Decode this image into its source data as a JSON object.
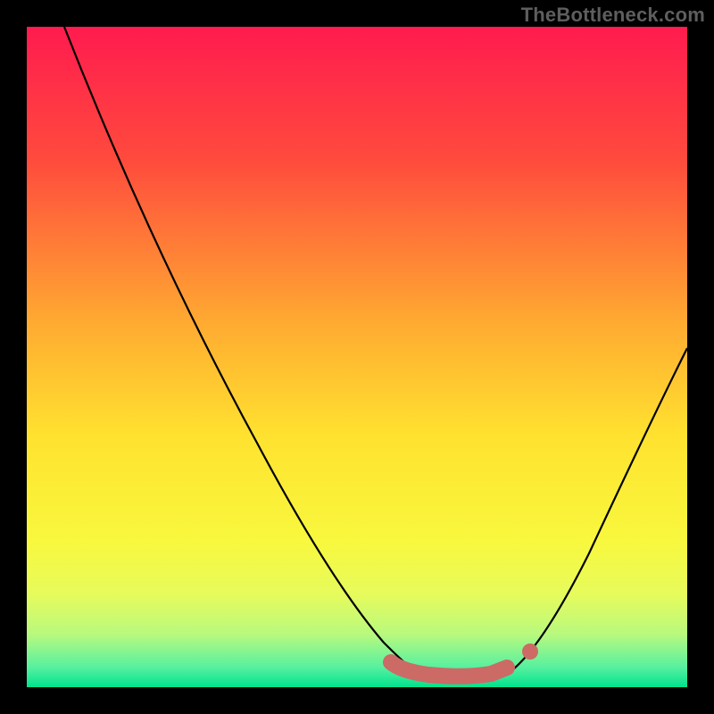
{
  "watermark": "TheBottleneck.com",
  "chart_data": {
    "type": "line",
    "title": "",
    "xlabel": "",
    "ylabel": "",
    "xlim": [
      0,
      100
    ],
    "ylim": [
      0,
      100
    ],
    "grid": false,
    "legend": false,
    "background": {
      "type": "vertical-gradient",
      "stops": [
        {
          "pos": 0.0,
          "color": "#ff1b4f"
        },
        {
          "pos": 0.2,
          "color": "#ff4a3d"
        },
        {
          "pos": 0.45,
          "color": "#ffab31"
        },
        {
          "pos": 0.62,
          "color": "#ffe22f"
        },
        {
          "pos": 0.78,
          "color": "#f8f83e"
        },
        {
          "pos": 0.86,
          "color": "#e6fb5c"
        },
        {
          "pos": 0.92,
          "color": "#b8f97e"
        },
        {
          "pos": 0.97,
          "color": "#57f0a0"
        },
        {
          "pos": 1.0,
          "color": "#00e38d"
        }
      ]
    },
    "series": [
      {
        "name": "bottleneck-curve",
        "x": [
          6,
          15,
          25,
          35,
          45,
          50,
          55,
          58,
          60,
          65,
          70,
          72,
          75,
          80,
          86,
          92,
          99
        ],
        "y": [
          100,
          84,
          66,
          48,
          30,
          20,
          10,
          5,
          3,
          1,
          1,
          2,
          5,
          15,
          30,
          48,
          66
        ]
      }
    ],
    "markers": {
      "flat_segment": {
        "x_start": 55,
        "x_end": 72,
        "y": 2
      },
      "dot": {
        "x": 76,
        "y": 6
      }
    },
    "colors": {
      "curve": "#000000",
      "marker": "#cc6a66",
      "frame": "#000000"
    }
  }
}
